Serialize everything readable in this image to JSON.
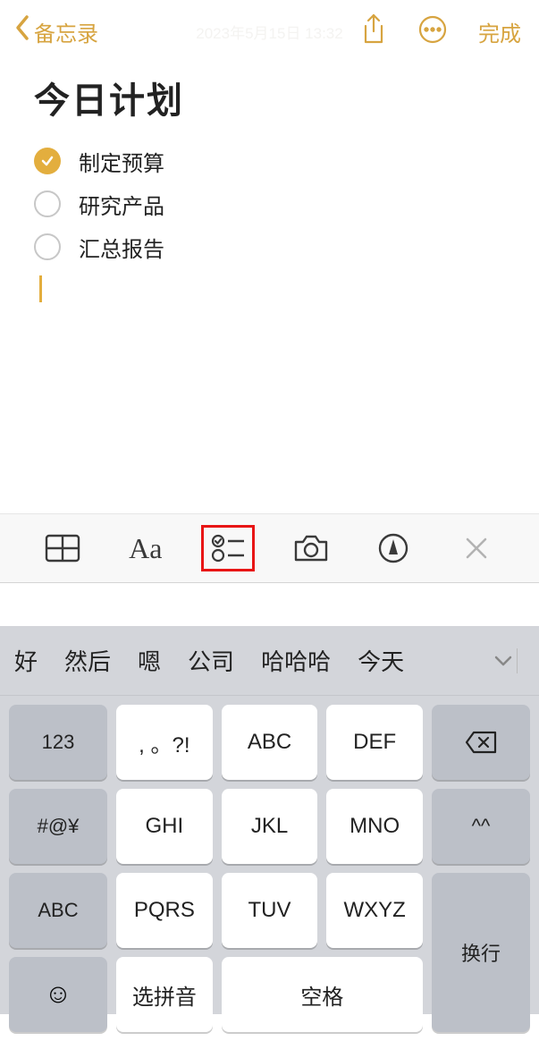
{
  "nav": {
    "back": "备忘录",
    "done": "完成",
    "date": "2023年5月15日 13:32"
  },
  "note": {
    "title": "今日计划",
    "items": [
      {
        "text": "制定预算",
        "done": true
      },
      {
        "text": "研究产品",
        "done": false
      },
      {
        "text": "汇总报告",
        "done": false
      }
    ]
  },
  "keyboard": {
    "suggestions": [
      "好",
      "然后",
      "嗯",
      "公司",
      "哈哈哈",
      "今天"
    ],
    "keys": {
      "r1c1": "123",
      "r1c2": ", 。?!",
      "r1c3": "ABC",
      "r1c4": "DEF",
      "r2c1": "#@¥",
      "r2c2": "GHI",
      "r2c3": "JKL",
      "r2c4": "MNO",
      "r2c5": "^^",
      "r3c1": "ABC",
      "r3c2": "PQRS",
      "r3c3": "TUV",
      "r3c4": "WXYZ",
      "space": "空格",
      "pinyin": "选拼音",
      "return": "换行"
    }
  }
}
